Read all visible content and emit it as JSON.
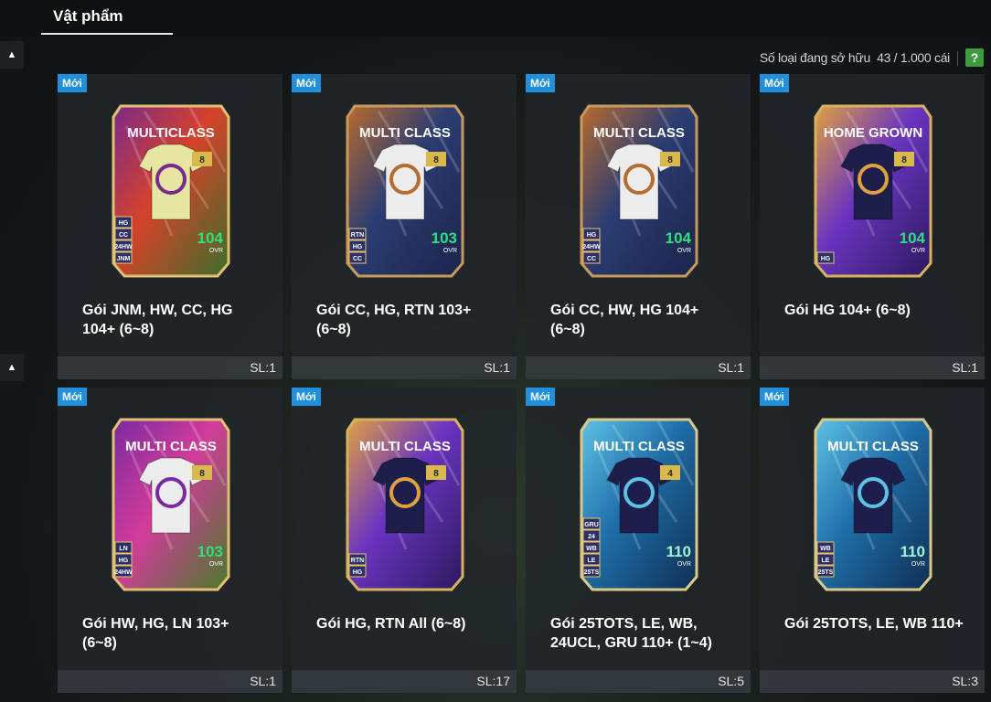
{
  "header": {
    "tab_label": "Vật phẩm"
  },
  "owned": {
    "label": "Số loại đang sở hữu",
    "value": "43 / 1.000 cái"
  },
  "help_label": "?",
  "side_arrow": "▲",
  "colors": {
    "new_badge": "#1f8fe0",
    "ovr_green": "#2ee07a",
    "help_green": "#3e9b3e"
  },
  "cards": [
    {
      "badge": "Mới",
      "title_line1": "Gói JNM, HW, CC, HG",
      "title_line2": "104+ (6~8)",
      "qty": "SL:1",
      "art": {
        "label": "MULTICLASS",
        "level": "8",
        "ovr": "104",
        "ovr_label": "OVR",
        "tags": [
          "HG",
          "CC",
          "24HW",
          "JNM"
        ],
        "shirt": "yellow",
        "theme": "multiclass-neon"
      }
    },
    {
      "badge": "Mới",
      "title_line1": "Gói CC, HG, RTN 103+",
      "title_line2": "(6~8)",
      "qty": "SL:1",
      "art": {
        "label": "MULTI CLASS",
        "level": "8",
        "ovr": "103",
        "ovr_label": "OVR",
        "tags": [
          "RTN",
          "HG",
          "CC"
        ],
        "shirt": "white",
        "theme": "bronze-navy"
      }
    },
    {
      "badge": "Mới",
      "title_line1": "Gói CC, HW, HG 104+",
      "title_line2": "(6~8)",
      "qty": "SL:1",
      "art": {
        "label": "MULTI CLASS",
        "level": "8",
        "ovr": "104",
        "ovr_label": "OVR",
        "tags": [
          "HG",
          "24HW",
          "CC"
        ],
        "shirt": "white",
        "theme": "bronze-navy"
      }
    },
    {
      "badge": "Mới",
      "title_line1": "Gói HG 104+ (6~8)",
      "title_line2": "",
      "qty": "SL:1",
      "art": {
        "label": "HOME GROWN",
        "level": "8",
        "ovr": "104",
        "ovr_label": "OVR",
        "tags": [
          "HG"
        ],
        "shirt": "navy",
        "theme": "purple-gold"
      }
    },
    {
      "badge": "Mới",
      "title_line1": "Gói HW, HG, LN 103+",
      "title_line2": "(6~8)",
      "qty": "SL:1",
      "art": {
        "label": "MULTI CLASS",
        "level": "8",
        "ovr": "103",
        "ovr_label": "OVR",
        "tags": [
          "LN",
          "HG",
          "24HW"
        ],
        "shirt": "white",
        "theme": "pink-neon"
      }
    },
    {
      "badge": "Mới",
      "title_line1": "Gói HG, RTN All (6~8)",
      "title_line2": "",
      "qty": "SL:17",
      "art": {
        "label": "MULTI CLASS",
        "level": "8",
        "ovr": "",
        "ovr_label": "",
        "tags": [
          "RTN",
          "HG"
        ],
        "shirt": "navy",
        "theme": "purple-gold"
      }
    },
    {
      "badge": "Mới",
      "title_line1": "Gói 25TOTS, LE, WB,",
      "title_line2": "24UCL, GRU 110+ (1~4)",
      "qty": "SL:5",
      "art": {
        "label": "MULTI CLASS",
        "level": "4",
        "ovr": "110",
        "ovr_label": "OVR",
        "tags": [
          "GRU",
          "24",
          "WB",
          "LE",
          "25TS"
        ],
        "shirt": "navy",
        "theme": "blue-tots"
      }
    },
    {
      "badge": "Mới",
      "title_line1": "Gói 25TOTS, LE, WB 110+",
      "title_line2": "",
      "qty": "SL:3",
      "art": {
        "label": "MULTI CLASS",
        "level": "",
        "ovr": "110",
        "ovr_label": "OVR",
        "tags": [
          "WB",
          "LE",
          "25TS"
        ],
        "shirt": "navy",
        "theme": "blue-tots"
      }
    }
  ]
}
